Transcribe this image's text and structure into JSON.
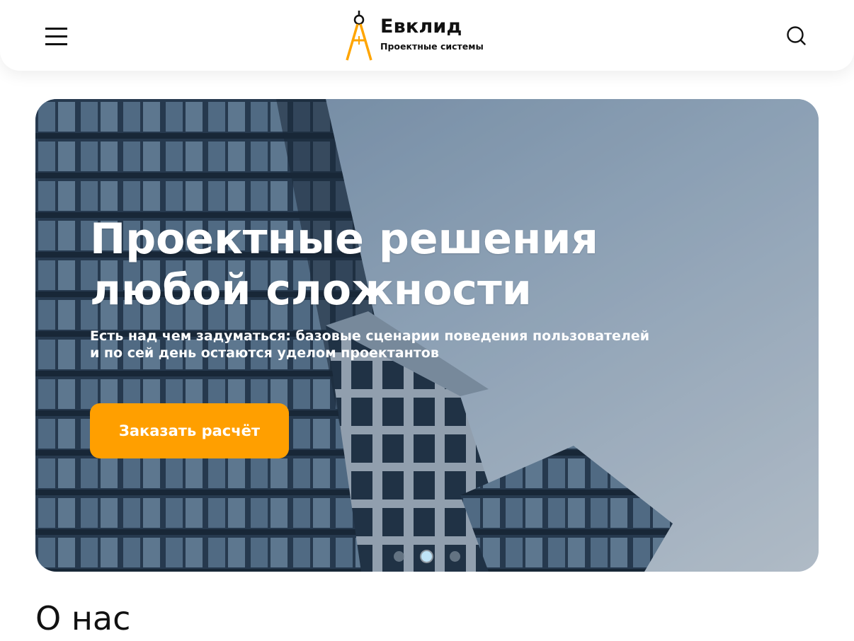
{
  "header": {
    "logo_title": "Евклид",
    "logo_subtitle": "Проектные системы",
    "menu_icon": "hamburger-menu-icon",
    "search_icon": "search-icon"
  },
  "hero": {
    "title_line1": "Проектные решения",
    "title_line2": "любой сложности",
    "subtitle_line1": "Есть над чем задуматься: базовые сценарии поведения пользователей",
    "subtitle_line2": "и по сей день остаются уделом проектантов",
    "cta_label": "Заказать расчёт",
    "slides": {
      "count": 3,
      "active_index": 1
    }
  },
  "about": {
    "heading": "О нас"
  },
  "colors": {
    "accent": "#ff9f00",
    "text_dark": "#111111",
    "dot_active": "#bfe3f7",
    "dot_inactive": "#7a8a97"
  }
}
